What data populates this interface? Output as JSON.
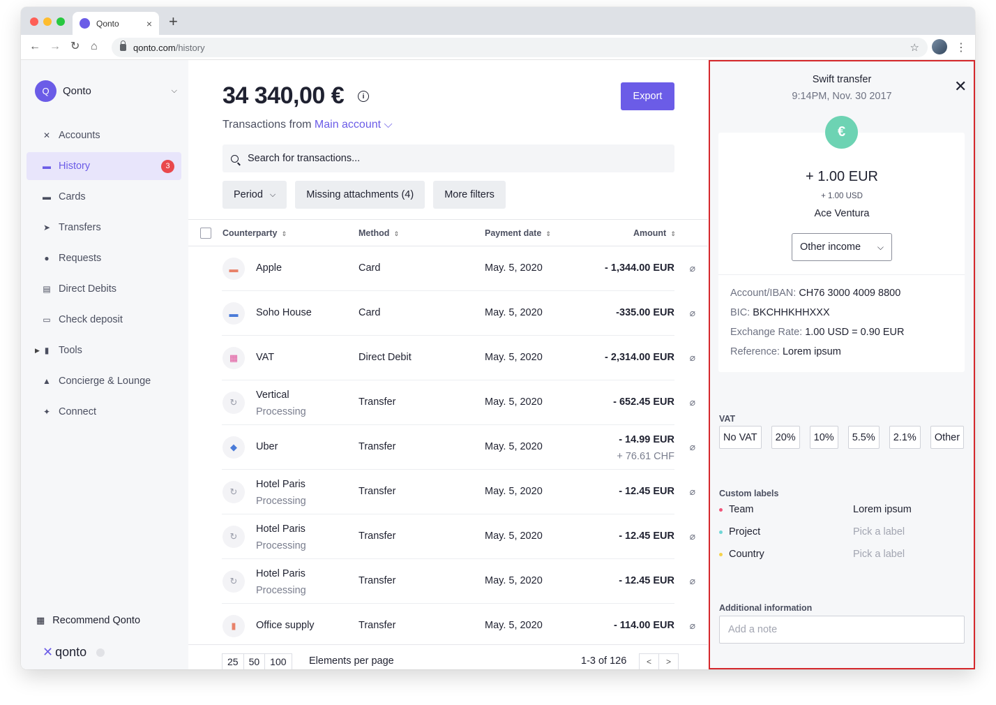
{
  "browser": {
    "tab_title": "Qonto",
    "tab_close": "×",
    "new_tab": "+",
    "url_host": "qonto.com",
    "url_path": "/history"
  },
  "sidebar": {
    "org_initial": "Q",
    "org_name": "Qonto",
    "items": [
      {
        "label": "Accounts",
        "icon": "accounts-icon",
        "glyph": "✕"
      },
      {
        "label": "History",
        "icon": "history-icon",
        "glyph": "▬",
        "badge": "3",
        "active": true
      },
      {
        "label": "Cards",
        "icon": "card-icon",
        "glyph": "▬"
      },
      {
        "label": "Transfers",
        "icon": "paper-plane-icon",
        "glyph": "➤"
      },
      {
        "label": "Requests",
        "icon": "request-icon",
        "glyph": "●"
      },
      {
        "label": "Direct Debits",
        "icon": "direct-debit-icon",
        "glyph": "▤"
      },
      {
        "label": "Check deposit",
        "icon": "check-icon",
        "glyph": "▭"
      },
      {
        "label": "Tools",
        "icon": "chart-icon",
        "glyph": "▮",
        "collapsible": true
      },
      {
        "label": "Concierge & Lounge",
        "icon": "bell-icon",
        "glyph": "▲"
      },
      {
        "label": "Connect",
        "icon": "plug-icon",
        "glyph": "✦"
      }
    ],
    "recommend": "Recommend Qonto",
    "brand": "qonto"
  },
  "main": {
    "balance": "34 340,00 €",
    "subtitle_prefix": "Transactions from",
    "account_name": "Main account",
    "export_label": "Export",
    "search_placeholder": "Search for transactions...",
    "filters": {
      "period": "Period",
      "missing": "Missing attachments (4)",
      "more": "More filters"
    },
    "columns": {
      "counterparty": "Counterparty",
      "method": "Method",
      "payment_date": "Payment date",
      "amount": "Amount"
    },
    "transactions": [
      {
        "counterparty": "Apple",
        "sub": "",
        "method": "Card",
        "date": "May. 5, 2020",
        "amount": "- 1,344.00 EUR",
        "amount_sub": "",
        "icon": "computer-icon",
        "glyph": "▬",
        "color": "#e8826a"
      },
      {
        "counterparty": "Soho House",
        "sub": "",
        "method": "Card",
        "date": "May. 5, 2020",
        "amount": "-335.00 EUR",
        "amount_sub": "",
        "icon": "bed-icon",
        "glyph": "▬",
        "color": "#4a7bd8"
      },
      {
        "counterparty": "VAT",
        "sub": "",
        "method": "Direct Debit",
        "date": "May. 5, 2020",
        "amount": "- 2,314.00 EUR",
        "amount_sub": "",
        "icon": "calculator-icon",
        "glyph": "▦",
        "color": "#e0559c"
      },
      {
        "counterparty": "Vertical",
        "sub": "Processing",
        "method": "Transfer",
        "date": "May. 5, 2020",
        "amount": "- 652.45 EUR",
        "amount_sub": "",
        "icon": "refresh-icon",
        "glyph": "↻",
        "color": "#9a9daa"
      },
      {
        "counterparty": "Uber",
        "sub": "",
        "method": "Transfer",
        "date": "May. 5, 2020",
        "amount": "- 14.99 EUR",
        "amount_sub": "+ 76.61 CHF",
        "icon": "car-icon",
        "glyph": "◆",
        "color": "#4a7bd8"
      },
      {
        "counterparty": "Hotel Paris",
        "sub": "Processing",
        "method": "Transfer",
        "date": "May. 5, 2020",
        "amount": "- 12.45 EUR",
        "amount_sub": "",
        "icon": "refresh-icon",
        "glyph": "↻",
        "color": "#9a9daa"
      },
      {
        "counterparty": "Hotel Paris",
        "sub": "Processing",
        "method": "Transfer",
        "date": "May. 5, 2020",
        "amount": "- 12.45 EUR",
        "amount_sub": "",
        "icon": "refresh-icon",
        "glyph": "↻",
        "color": "#9a9daa"
      },
      {
        "counterparty": "Hotel Paris",
        "sub": "Processing",
        "method": "Transfer",
        "date": "May. 5, 2020",
        "amount": "- 12.45 EUR",
        "amount_sub": "",
        "icon": "refresh-icon",
        "glyph": "↻",
        "color": "#9a9daa"
      },
      {
        "counterparty": "Office supply",
        "sub": "",
        "method": "Transfer",
        "date": "May. 5, 2020",
        "amount": "- 114.00 EUR",
        "amount_sub": "",
        "icon": "books-icon",
        "glyph": "▮",
        "color": "#e8826a"
      }
    ],
    "pagination": {
      "sizes": [
        "25",
        "50",
        "100"
      ],
      "per_page_label": "Elements per page",
      "range": "1-3 of 126"
    }
  },
  "detail": {
    "title": "Swift transfer",
    "time": "9:14PM, Nov. 30 2017",
    "amount": "+ 1.00 EUR",
    "amount_sub": "+ 1.00 USD",
    "counterparty": "Ace Ventura",
    "category": "Other income",
    "fields": [
      {
        "key": "Account/IBAN:",
        "value": "CH76 3000 4009 8800"
      },
      {
        "key": "BIC:",
        "value": "BKCHHKHHXXX"
      },
      {
        "key": "Exchange Rate:",
        "value": "1.00 USD = 0.90 EUR"
      },
      {
        "key": "Reference:",
        "value": "Lorem ipsum"
      }
    ],
    "vat_title": "VAT",
    "vat_options": [
      "No VAT",
      "20%",
      "10%",
      "5.5%",
      "2.1%",
      "Other"
    ],
    "labels_title": "Custom labels",
    "labels": [
      {
        "name": "Team",
        "value": "Lorem ipsum",
        "color": "#f0567a",
        "placeholder": false
      },
      {
        "name": "Project",
        "value": "Pick a label",
        "color": "#6fd6d6",
        "placeholder": true
      },
      {
        "name": "Country",
        "value": "Pick a label",
        "color": "#f5d24a",
        "placeholder": true
      }
    ],
    "additional_title": "Additional information",
    "note_placeholder": "Add a note"
  },
  "colors": {
    "accent": "#6b5ce7",
    "badge": "#e9484c",
    "highlight_border": "#d5282c"
  }
}
